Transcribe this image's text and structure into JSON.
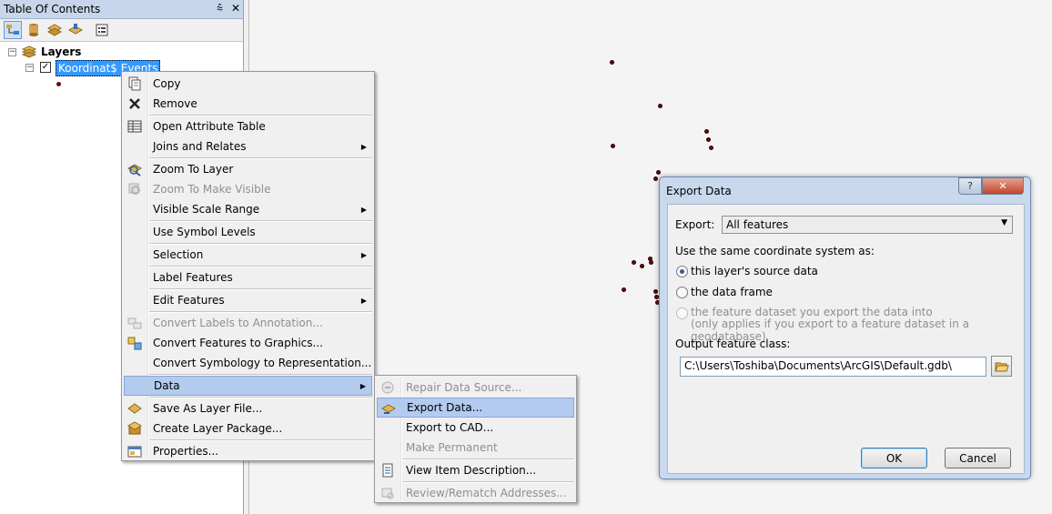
{
  "toc": {
    "title": "Table Of Contents",
    "pin": "⩯",
    "close": "✕",
    "toolbar_icons": [
      "list-by-drawing-order-icon",
      "list-by-source-icon",
      "list-by-visibility-icon",
      "list-by-selection-icon",
      "options-icon"
    ],
    "layers_label": "Layers",
    "layer_name": "Koordinat$ Events"
  },
  "context_menu": {
    "items": {
      "copy": "Copy",
      "remove": "Remove",
      "open_attribute_table": "Open Attribute Table",
      "joins_and_relates": "Joins and Relates",
      "zoom_to_layer": "Zoom To Layer",
      "zoom_to_make_visible": "Zoom To Make Visible",
      "visible_scale_range": "Visible Scale Range",
      "use_symbol_levels": "Use Symbol Levels",
      "selection": "Selection",
      "label_features": "Label Features",
      "edit_features": "Edit Features",
      "convert_labels": "Convert Labels to Annotation...",
      "convert_features": "Convert Features to Graphics...",
      "convert_symbology": "Convert Symbology to Representation...",
      "data": "Data",
      "save_as_layer_file": "Save As Layer File...",
      "create_layer_package": "Create Layer Package...",
      "properties": "Properties..."
    }
  },
  "data_submenu": {
    "items": {
      "repair_data_source": "Repair Data Source...",
      "export_data": "Export Data...",
      "export_to_cad": "Export to CAD...",
      "make_permanent": "Make Permanent",
      "view_item_description": "View Item Description...",
      "review_rematch": "Review/Rematch Addresses..."
    }
  },
  "dialog": {
    "title": "Export Data",
    "help_button": "?",
    "close_button": "✕",
    "export_label": "Export:",
    "export_value": "All features",
    "coord_label": "Use the same coordinate system as:",
    "radio_source": "this layer's source data",
    "radio_frame": "the data frame",
    "radio_dataset_line1": "the feature dataset you export the data into",
    "radio_dataset_line2": "(only applies if you export to a feature dataset in a geodatabase)",
    "output_label": "Output feature class:",
    "output_value": "C:\\Users\\Toshiba\\Documents\\ArcGIS\\Default.gdb\\",
    "ok": "OK",
    "cancel": "Cancel"
  },
  "colors": {
    "point_fill": "#6b0b0b",
    "highlight": "#b3cbee",
    "dialog_frame": "#c8d9ee"
  }
}
